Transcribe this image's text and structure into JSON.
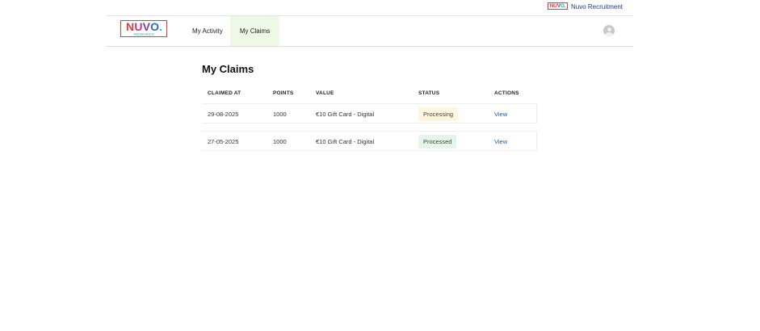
{
  "topbar": {
    "mini_logo": {
      "n": "NU",
      "v": "V",
      "o": "O."
    },
    "brand_link": "Nuvo Recruitment"
  },
  "logo": {
    "letters": [
      "N",
      "U",
      "V",
      "O",
      "."
    ],
    "subtitle": "REWARDS"
  },
  "nav": {
    "items": [
      {
        "label": "My Activity",
        "active": false
      },
      {
        "label": "My Claims",
        "active": true
      }
    ],
    "avatar_icon": "user-avatar-icon"
  },
  "page": {
    "title": "My Claims"
  },
  "table": {
    "headers": [
      "CLAIMED AT",
      "POINTS",
      "VALUE",
      "STATUS",
      "ACTIONS"
    ],
    "rows": [
      {
        "claimed_at": "29-08-2025",
        "points": "1000",
        "value": "€10 Gift Card - Digital",
        "status": "Processing",
        "action": "View"
      },
      {
        "claimed_at": "27-05-2025",
        "points": "1000",
        "value": "€10 Gift Card - Digital",
        "status": "Processed",
        "action": "View"
      }
    ]
  },
  "colors": {
    "active_nav_bg": "#eef8e6",
    "processing_badge_bg": "#fdf6df",
    "processed_badge_bg": "#e6f5ea",
    "link": "#1f55c9",
    "brand_red": "#e23b3b",
    "brand_teal": "#1bb6a8"
  }
}
